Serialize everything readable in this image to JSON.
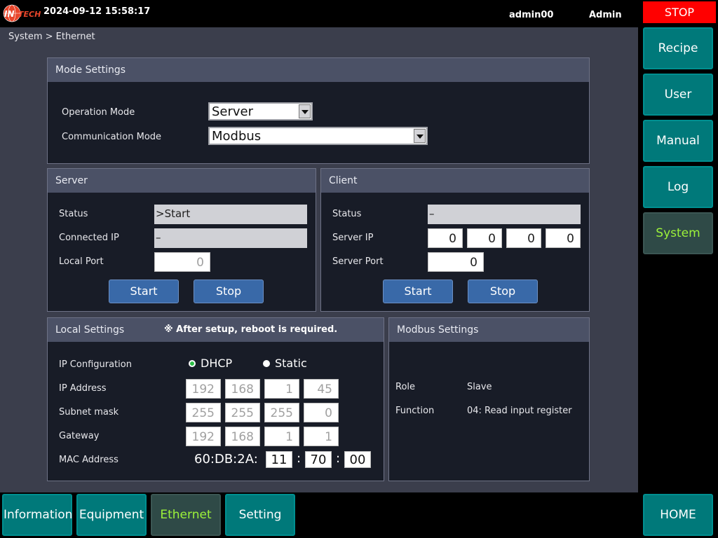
{
  "header": {
    "logo_text": "INTECH",
    "datetime": "2024-09-12 15:58:17",
    "user_name": "admin00",
    "user_role": "Admin",
    "stop_label": "STOP"
  },
  "breadcrumb": "System > Ethernet",
  "mode_settings": {
    "title": "Mode Settings",
    "operation_mode_label": "Operation Mode",
    "operation_mode_value": "Server",
    "communication_mode_label": "Communication Mode",
    "communication_mode_value": "Modbus"
  },
  "server": {
    "title": "Server",
    "status_label": "Status",
    "status_value": ">Start",
    "connected_ip_label": "Connected IP",
    "connected_ip_value": "–",
    "local_port_label": "Local Port",
    "local_port_value": "0",
    "start_label": "Start",
    "stop_label": "Stop"
  },
  "client": {
    "title": "Client",
    "status_label": "Status",
    "status_value": "–",
    "server_ip_label": "Server IP",
    "server_ip": [
      "0",
      "0",
      "0",
      "0"
    ],
    "server_port_label": "Server Port",
    "server_port_value": "0",
    "start_label": "Start",
    "stop_label": "Stop"
  },
  "local_settings": {
    "title": "Local Settings",
    "note": "※ After setup, reboot is required.",
    "ip_config_label": "IP Configuration",
    "dhcp_label": "DHCP",
    "static_label": "Static",
    "selected": "DHCP",
    "ip_address_label": "IP Address",
    "ip_address": [
      "192",
      "168",
      "1",
      "45"
    ],
    "subnet_label": "Subnet mask",
    "subnet": [
      "255",
      "255",
      "255",
      "0"
    ],
    "gateway_label": "Gateway",
    "gateway": [
      "192",
      "168",
      "1",
      "1"
    ],
    "mac_label": "MAC Address",
    "mac_prefix": "60:DB:2A:",
    "mac_parts": [
      "11",
      "70",
      "00"
    ],
    "mac_sep": ":"
  },
  "modbus_settings": {
    "title": "Modbus Settings",
    "role_label": "Role",
    "role_value": "Slave",
    "function_label": "Function",
    "function_value": "04: Read input register"
  },
  "sidebar": {
    "items": [
      {
        "label": "Recipe"
      },
      {
        "label": "User"
      },
      {
        "label": "Manual"
      },
      {
        "label": "Log"
      },
      {
        "label": "System"
      }
    ],
    "active": "System",
    "home_label": "HOME"
  },
  "bottom_tabs": {
    "items": [
      {
        "label": "Information"
      },
      {
        "label": "Equipment"
      },
      {
        "label": "Ethernet"
      },
      {
        "label": "Setting"
      }
    ],
    "active": "Ethernet"
  },
  "colors": {
    "accent_teal": "#00797a",
    "active_text": "#9cf23a",
    "stop_red": "#ff0000",
    "button_blue": "#3969a8",
    "dhcp_green": "#2bbd45"
  }
}
